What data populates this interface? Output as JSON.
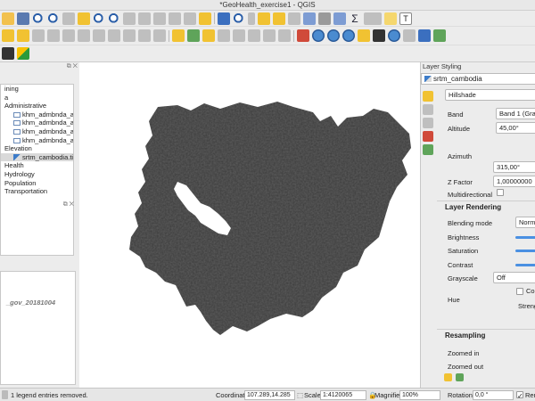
{
  "window": {
    "title": "*GeoHealth_exercise1 - QGIS"
  },
  "layers_panel": {
    "rows": [
      {
        "label": "ining",
        "level": 1,
        "icon": "none"
      },
      {
        "label": "a",
        "level": 1,
        "icon": "none"
      },
      {
        "label": "Administrative",
        "level": 1,
        "icon": "none"
      },
      {
        "label": "khm_admbnda_adm0_g",
        "level": 2,
        "icon": "vector-layer-icon"
      },
      {
        "label": "khm_admbnda_adm1_g",
        "level": 2,
        "icon": "vector-layer-icon"
      },
      {
        "label": "khm_admbnda_adm2_g",
        "level": 2,
        "icon": "vector-layer-icon"
      },
      {
        "label": "khm_admbnda_adm3_g",
        "level": 2,
        "icon": "vector-layer-icon"
      },
      {
        "label": "Elevation",
        "level": 1,
        "icon": "none"
      },
      {
        "label": "srtm_cambodia.tif",
        "level": 2,
        "icon": "raster-layer-icon",
        "selected": true
      },
      {
        "label": "Health",
        "level": 1,
        "icon": "none"
      },
      {
        "label": "Hydrology",
        "level": 1,
        "icon": "none"
      },
      {
        "label": "Population",
        "level": 1,
        "icon": "none"
      },
      {
        "label": "Transportation",
        "level": 1,
        "icon": "none"
      }
    ]
  },
  "browser_panel": {
    "item": "_gov_20181004"
  },
  "layer_styling": {
    "panel_title": "Layer Styling",
    "layer_name": "srtm_cambodia",
    "renderer": "Hillshade",
    "band_label": "Band",
    "band_value": "Band 1 (Gray)",
    "altitude_label": "Altitude",
    "altitude_value": "45,00°",
    "azimuth_label": "Azimuth",
    "azimuth_value": "315,00°",
    "zfactor_label": "Z Factor",
    "zfactor_value": "1,00000000",
    "multidirectional_label": "Multidirectional",
    "layer_rendering_title": "Layer Rendering",
    "blending_mode_label": "Blending mode",
    "blending_mode_value": "Norma",
    "brightness_label": "Brightness",
    "saturation_label": "Saturation",
    "contrast_label": "Contrast",
    "grayscale_label": "Grayscale",
    "grayscale_value": "Off",
    "hue_label": "Hue",
    "colorize_label": "Colo",
    "strength_label": "Streng",
    "resampling_title": "Resampling",
    "zoomed_in_label": "Zoomed in",
    "zoomed_out_label": "Zoomed out"
  },
  "status_bar": {
    "message": "1 legend entries removed.",
    "coordinate_label": "Coordinate",
    "coordinate_value": "107.289,14.285",
    "scale_label": "Scale",
    "scale_value": "1:4120065",
    "magnifier_label": "Magnifier",
    "magnifier_value": "100%",
    "rotation_label": "Rotation",
    "rotation_value": "0,0 °",
    "render_label": "Rend"
  }
}
